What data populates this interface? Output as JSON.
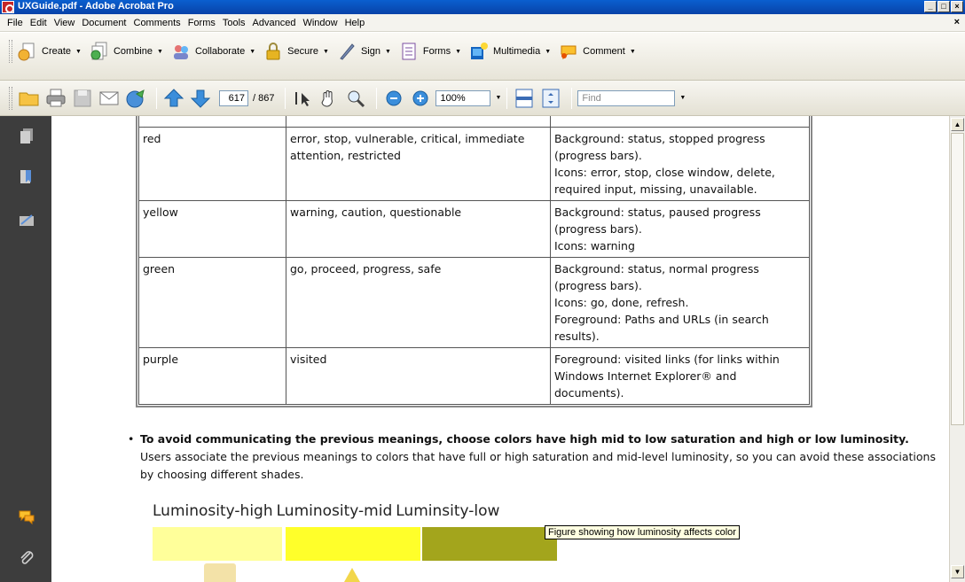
{
  "window": {
    "title": "UXGuide.pdf - Adobe Acrobat Pro",
    "controls": [
      "_",
      "□",
      "×"
    ]
  },
  "menu": {
    "items": [
      "File",
      "Edit",
      "View",
      "Document",
      "Comments",
      "Forms",
      "Tools",
      "Advanced",
      "Window",
      "Help"
    ],
    "close": "×"
  },
  "tasks_toolbar": {
    "items": [
      {
        "label": "Create",
        "icon": "create-icon"
      },
      {
        "label": "Combine",
        "icon": "combine-icon"
      },
      {
        "label": "Collaborate",
        "icon": "collaborate-icon"
      },
      {
        "label": "Secure",
        "icon": "lock-icon"
      },
      {
        "label": "Sign",
        "icon": "pen-icon"
      },
      {
        "label": "Forms",
        "icon": "form-icon"
      },
      {
        "label": "Multimedia",
        "icon": "multimedia-icon"
      },
      {
        "label": "Comment",
        "icon": "comment-icon"
      }
    ],
    "caret": "▼"
  },
  "nav_toolbar": {
    "current_page": "617",
    "total_pages": "/ 867",
    "zoom": "100%",
    "find_placeholder": "Find"
  },
  "table": {
    "rows": [
      {
        "color": "red",
        "meaning": "error, stop, vulnerable, critical, immediate attention, restricted",
        "usage": [
          "Background: status, stopped progress (progress bars).",
          "Icons: error, stop, close window, delete, required input, missing, unavailable."
        ]
      },
      {
        "color": "yellow",
        "meaning": "warning, caution, questionable",
        "usage": [
          "Background: status, paused progress (progress bars).",
          "Icons: warning"
        ]
      },
      {
        "color": "green",
        "meaning": "go, proceed, progress, safe",
        "usage": [
          "Background: status, normal progress (progress bars).",
          "Icons: go, done, refresh.",
          "Foreground: Paths and URLs (in search results)."
        ]
      },
      {
        "color": "purple",
        "meaning": "visited",
        "usage": [
          "Foreground: visited links (for links within Windows Internet Explorer® and documents)."
        ]
      }
    ]
  },
  "bullet": {
    "mark": "•",
    "bold": "To avoid communicating the previous meanings, choose colors have high mid to low saturation and high or low luminosity.",
    "normal": "Users associate the previous meanings to colors that have full or high saturation and mid-level luminosity, so you can avoid these associations by choosing different shades."
  },
  "figure": {
    "labels": [
      "Luminosity-high",
      "Luminosity-mid",
      "Luminsity-low"
    ],
    "swatch_colors": [
      "#ffff9a",
      "#ffff2a",
      "#a3a51c"
    ],
    "tooltip": "Figure showing how luminosity affects color"
  }
}
